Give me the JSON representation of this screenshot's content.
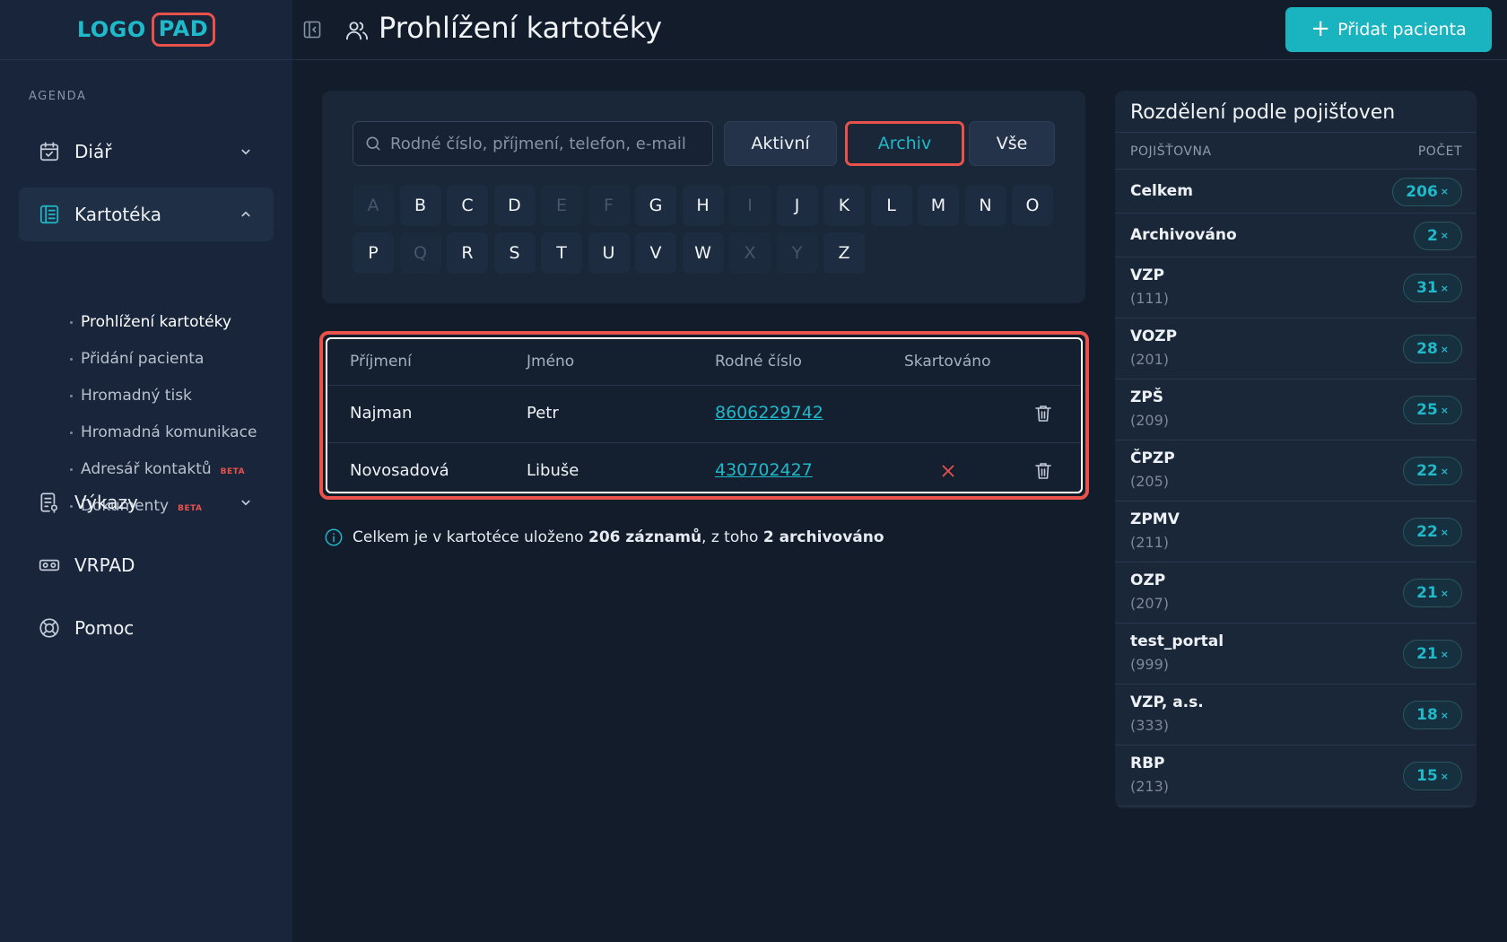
{
  "app": {
    "logo_left": "LOGO",
    "logo_right": "PAD"
  },
  "sidebar": {
    "agenda_label": "AGENDA",
    "items": [
      {
        "label": "Diář",
        "icon": "calendar-icon"
      },
      {
        "label": "Kartotéka",
        "icon": "card-index-icon"
      },
      {
        "label": "Výkazy",
        "icon": "report-icon"
      },
      {
        "label": "VRPAD",
        "icon": "vr-headset-icon"
      },
      {
        "label": "Pomoc",
        "icon": "lifebuoy-icon"
      }
    ],
    "subitems": [
      {
        "label": "Prohlížení kartotéky",
        "badge": ""
      },
      {
        "label": "Přidání pacienta",
        "badge": ""
      },
      {
        "label": "Hromadný tisk",
        "badge": ""
      },
      {
        "label": "Hromadná komunikace",
        "badge": ""
      },
      {
        "label": "Adresář kontaktů",
        "badge": "BETA"
      },
      {
        "label": "Dokumenty",
        "badge": "BETA"
      }
    ]
  },
  "header": {
    "title": "Prohlížení kartotéky",
    "add_button": "Přidat pacienta"
  },
  "filter": {
    "search_placeholder": "Rodné číslo, příjmení, telefon, e-mail",
    "buttons": [
      "Aktivní",
      "Archiv",
      "Vše"
    ],
    "selected": "Archiv",
    "letters_row1": [
      "A",
      "B",
      "C",
      "D",
      "E",
      "F",
      "G",
      "H",
      "I",
      "J",
      "K",
      "L",
      "M",
      "N",
      "O"
    ],
    "letters_row2": [
      "P",
      "Q",
      "R",
      "S",
      "T",
      "U",
      "V",
      "W",
      "X",
      "Y",
      "Z"
    ],
    "disabled_letters": [
      "A",
      "E",
      "F",
      "I",
      "Q",
      "X",
      "Y"
    ]
  },
  "table": {
    "columns": [
      "Příjmení",
      "Jméno",
      "Rodné číslo",
      "Skartováno"
    ],
    "rows": [
      {
        "surname": "Najman",
        "name": "Petr",
        "birth_number": "8606229742",
        "shredded": false
      },
      {
        "surname": "Novosadová",
        "name": "Libuše",
        "birth_number": "430702427",
        "shredded": true
      }
    ]
  },
  "summary": {
    "prefix": "Celkem je v kartotéce uloženo ",
    "total": "206 záznamů",
    "middle": ", z toho ",
    "archived": "2 archivováno"
  },
  "insurance": {
    "title": "Rozdělení podle pojišťoven",
    "col_name": "POJIŠŤOVNA",
    "col_count": "POČET",
    "rows": [
      {
        "name": "Celkem",
        "code": "",
        "count": "206"
      },
      {
        "name": "Archivováno",
        "code": "",
        "count": "2"
      },
      {
        "name": "VZP",
        "code": "(111)",
        "count": "31"
      },
      {
        "name": "VOZP",
        "code": "(201)",
        "count": "28"
      },
      {
        "name": "ZPŠ",
        "code": "(209)",
        "count": "25"
      },
      {
        "name": "ČPZP",
        "code": "(205)",
        "count": "22"
      },
      {
        "name": "ZPMV",
        "code": "(211)",
        "count": "22"
      },
      {
        "name": "OZP",
        "code": "(207)",
        "count": "21"
      },
      {
        "name": "test_portal",
        "code": "(999)",
        "count": "21"
      },
      {
        "name": "VZP, a.s.",
        "code": "(333)",
        "count": "18"
      },
      {
        "name": "RBP",
        "code": "(213)",
        "count": "15"
      }
    ],
    "count_suffix": "×"
  },
  "colors": {
    "accent": "#1ab3c0",
    "highlight": "#e8524a",
    "background": "#121c2b"
  }
}
